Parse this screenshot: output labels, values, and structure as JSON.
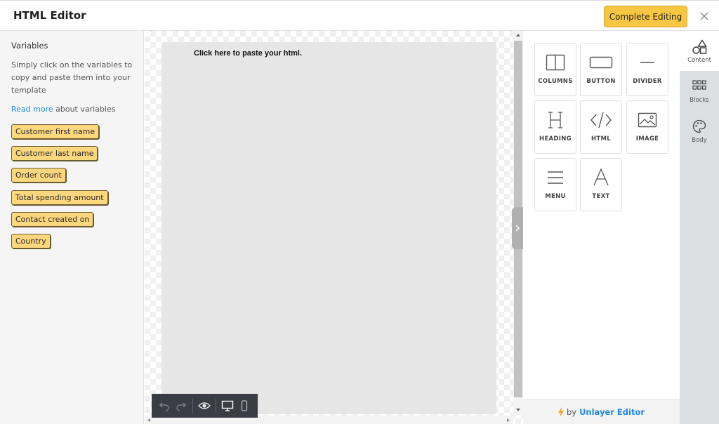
{
  "header": {
    "title": "HTML Editor",
    "complete_label": "Complete Editing",
    "accent": "#f7c642"
  },
  "variables": {
    "heading": "Variables",
    "description": "Simply click on the variables to copy and paste them into your template",
    "read_more_link": "Read more",
    "read_more_suffix": " about variables",
    "chips": [
      "Customer first name",
      "Customer last name",
      "Order count",
      "Total spending amount",
      "Contact created on",
      "Country"
    ]
  },
  "canvas": {
    "paste_hint": "Click here to paste your html."
  },
  "toolbar": {
    "icons": [
      "undo-icon",
      "redo-icon",
      "preview-eye-icon",
      "desktop-icon",
      "mobile-icon"
    ]
  },
  "tools": [
    {
      "label": "COLUMNS",
      "icon": "columns-icon"
    },
    {
      "label": "BUTTON",
      "icon": "button-icon"
    },
    {
      "label": "DIVIDER",
      "icon": "divider-icon"
    },
    {
      "label": "HEADING",
      "icon": "heading-icon"
    },
    {
      "label": "HTML",
      "icon": "html-code-icon"
    },
    {
      "label": "IMAGE",
      "icon": "image-icon"
    },
    {
      "label": "MENU",
      "icon": "menu-icon"
    },
    {
      "label": "TEXT",
      "icon": "text-icon"
    }
  ],
  "footer": {
    "by": "by",
    "brand": "Unlayer Editor"
  },
  "rail": {
    "tabs": [
      {
        "label": "Content",
        "icon": "shapes-icon",
        "active": true
      },
      {
        "label": "Blocks",
        "icon": "blocks-grid-icon",
        "active": false
      },
      {
        "label": "Body",
        "icon": "palette-icon",
        "active": false
      }
    ]
  }
}
